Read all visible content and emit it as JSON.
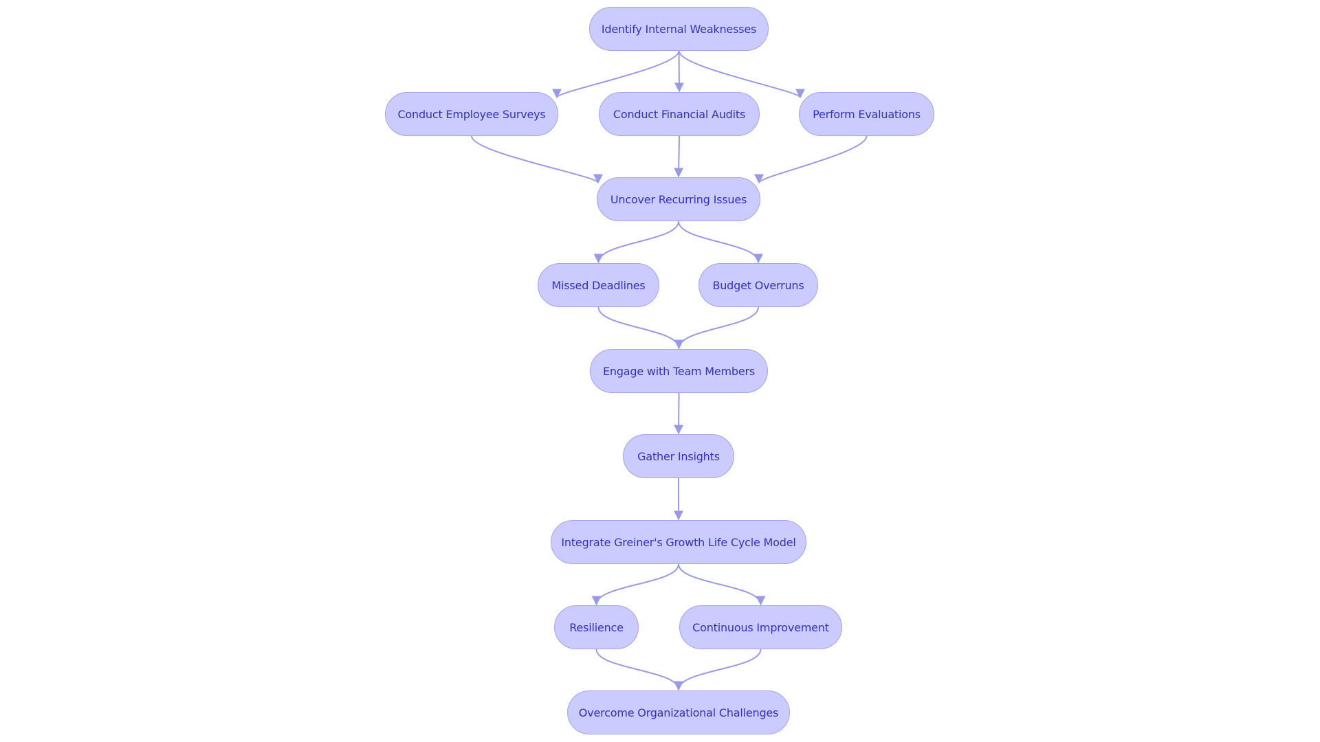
{
  "colors": {
    "node_fill": "#cbcbff",
    "node_border": "#a3a3ee",
    "text": "#3232b8",
    "edge": "#9999e6"
  },
  "nodes": [
    {
      "id": "n1",
      "label": "Identify Internal Weaknesses"
    },
    {
      "id": "n2",
      "label": "Conduct Employee Surveys"
    },
    {
      "id": "n3",
      "label": "Conduct Financial Audits"
    },
    {
      "id": "n4",
      "label": "Perform Evaluations"
    },
    {
      "id": "n5",
      "label": "Uncover Recurring Issues"
    },
    {
      "id": "n6",
      "label": "Missed Deadlines"
    },
    {
      "id": "n7",
      "label": "Budget Overruns"
    },
    {
      "id": "n8",
      "label": "Engage with Team Members"
    },
    {
      "id": "n9",
      "label": "Gather Insights"
    },
    {
      "id": "n10",
      "label": "Integrate Greiner's Growth Life Cycle Model"
    },
    {
      "id": "n11",
      "label": "Resilience"
    },
    {
      "id": "n12",
      "label": "Continuous Improvement"
    },
    {
      "id": "n13",
      "label": "Overcome Organizational Challenges"
    }
  ],
  "edges": [
    [
      "n1",
      "n2"
    ],
    [
      "n1",
      "n3"
    ],
    [
      "n1",
      "n4"
    ],
    [
      "n2",
      "n5"
    ],
    [
      "n3",
      "n5"
    ],
    [
      "n4",
      "n5"
    ],
    [
      "n5",
      "n6"
    ],
    [
      "n5",
      "n7"
    ],
    [
      "n6",
      "n8"
    ],
    [
      "n7",
      "n8"
    ],
    [
      "n8",
      "n9"
    ],
    [
      "n9",
      "n10"
    ],
    [
      "n10",
      "n11"
    ],
    [
      "n10",
      "n12"
    ],
    [
      "n11",
      "n13"
    ],
    [
      "n12",
      "n13"
    ]
  ]
}
